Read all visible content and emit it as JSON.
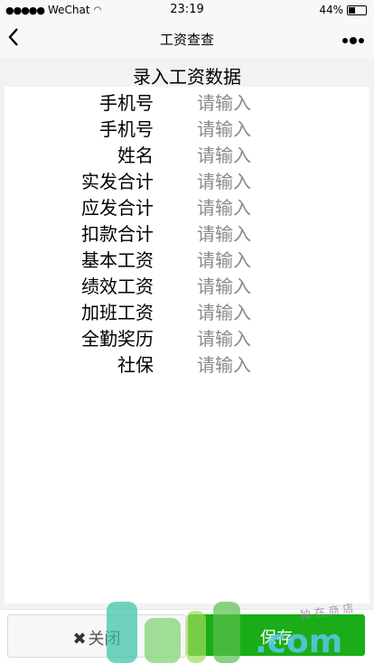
{
  "status_bar": {
    "signal": "●●●●●",
    "carrier": "WeChat",
    "wifi_icon": "wifi-icon",
    "time": "23:19",
    "battery_text": "44%",
    "battery_level": 0.44
  },
  "nav": {
    "back_icon": "chevron-left-icon",
    "title": "工资查查",
    "more_icon": "more-dots-icon"
  },
  "form": {
    "title": "录入工资数据",
    "rows": [
      {
        "label": "手机号",
        "placeholder": "请输入"
      },
      {
        "label": "手机号",
        "placeholder": "请输入"
      },
      {
        "label": "姓名",
        "placeholder": "请输入"
      },
      {
        "label": "实发合计",
        "placeholder": "请输入"
      },
      {
        "label": "应发合计",
        "placeholder": "请输入"
      },
      {
        "label": "扣款合计",
        "placeholder": "请输入"
      },
      {
        "label": "基本工资",
        "placeholder": "请输入"
      },
      {
        "label": "绩效工资",
        "placeholder": "请输入"
      },
      {
        "label": "加班工资",
        "placeholder": "请输入"
      },
      {
        "label": "全勤奖历",
        "placeholder": "请输入"
      },
      {
        "label": "社保",
        "placeholder": "请输入"
      }
    ]
  },
  "buttons": {
    "close_label": "关闭",
    "save_label": "保存",
    "save_color": "#1aad19"
  },
  "watermark": {
    "text": ".com",
    "cn_text": "独 在 商 店"
  }
}
